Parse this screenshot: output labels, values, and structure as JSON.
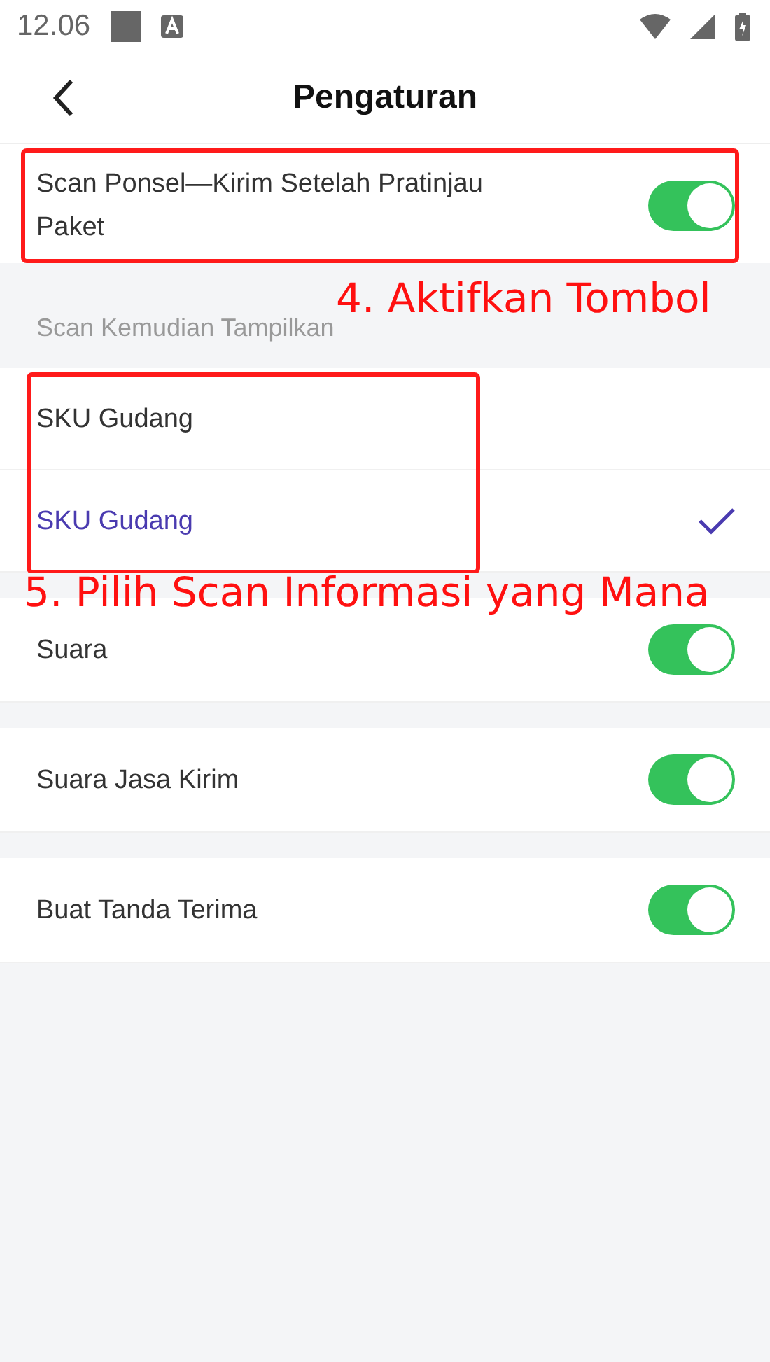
{
  "status_bar": {
    "time": "12.06"
  },
  "header": {
    "title": "Pengaturan"
  },
  "preview_toggle": {
    "label": "Scan Ponsel—Kirim Setelah Pratinjau Paket",
    "on": true
  },
  "scan_display": {
    "heading": "Scan Kemudian Tampilkan",
    "options": [
      {
        "label": "SKU Gudang",
        "selected": false
      },
      {
        "label": "SKU Gudang",
        "selected": true
      }
    ]
  },
  "toggles": [
    {
      "label": "Suara",
      "on": true
    },
    {
      "label": "Suara Jasa Kirim",
      "on": true
    },
    {
      "label": "Buat Tanda Terima",
      "on": true
    }
  ],
  "annotations": [
    {
      "text": "4. Aktifkan Tombol"
    },
    {
      "text": "5. Pilih Scan Informasi yang Mana"
    }
  ]
}
